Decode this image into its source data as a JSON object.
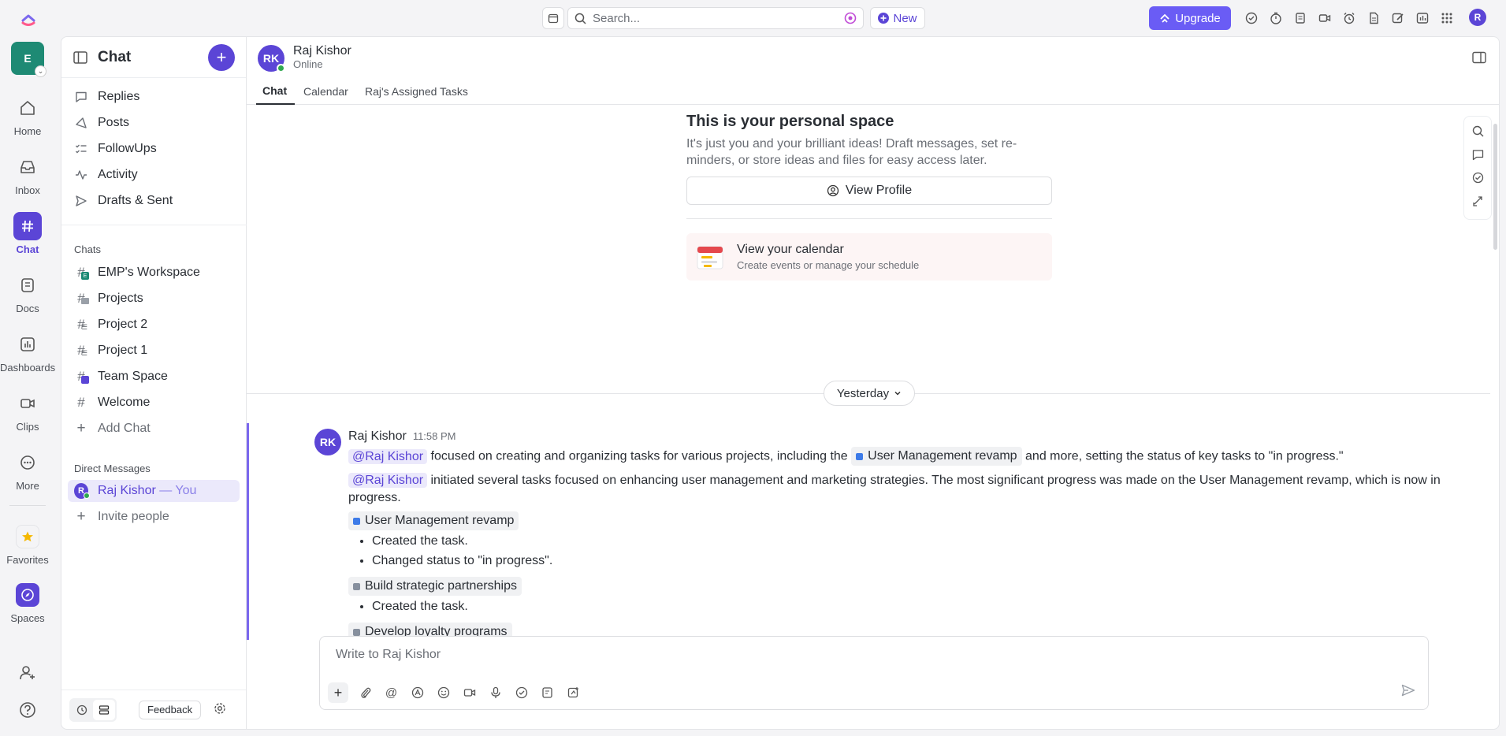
{
  "topbar": {
    "search_placeholder": "Search...",
    "new_label": "New",
    "upgrade_label": "Upgrade",
    "user_initial": "R"
  },
  "rail": {
    "workspace_initial": "E",
    "items": [
      {
        "label": "Home"
      },
      {
        "label": "Inbox"
      },
      {
        "label": "Chat"
      },
      {
        "label": "Docs"
      },
      {
        "label": "Dashboards"
      },
      {
        "label": "Clips"
      },
      {
        "label": "More"
      },
      {
        "label": "Favorites"
      },
      {
        "label": "Spaces"
      }
    ]
  },
  "sidebar": {
    "title": "Chat",
    "top_items": [
      {
        "label": "Replies"
      },
      {
        "label": "Posts"
      },
      {
        "label": "FollowUps"
      },
      {
        "label": "Activity"
      },
      {
        "label": "Drafts & Sent"
      }
    ],
    "chats_header": "Chats",
    "chats": [
      {
        "label": "EMP's Workspace",
        "badge": "E"
      },
      {
        "label": "Projects"
      },
      {
        "label": "Project 2"
      },
      {
        "label": "Project 1"
      },
      {
        "label": "Team Space"
      },
      {
        "label": "Welcome"
      },
      {
        "label": "Add Chat"
      }
    ],
    "dm_header": "Direct Messages",
    "dm_user": "Raj Kishor",
    "dm_you": " — You",
    "dm_initial": "R",
    "invite_label": "Invite people",
    "feedback_label": "Feedback"
  },
  "chat_header": {
    "initials": "RK",
    "name": "Raj Kishor",
    "status": "Online",
    "tabs": [
      {
        "label": "Chat"
      },
      {
        "label": "Calendar"
      },
      {
        "label": "Raj's Assigned Tasks"
      }
    ]
  },
  "personal_space": {
    "title": "This is your personal space",
    "description_line1": "It's just you and your brilliant ideas! Draft messages, set re-",
    "description_line2": "minders, or store ideas and files for easy access later.",
    "view_profile_label": "View Profile",
    "calendar_title": "View your calendar",
    "calendar_subtitle": "Create events or manage your schedule"
  },
  "day_divider": "Yesterday",
  "message": {
    "initials": "RK",
    "author": "Raj Kishor",
    "time": "11:58 PM",
    "mention": "@Raj Kishor",
    "line1_a": "focused on creating and organizing tasks for various projects, including the",
    "line1_chip": "User Management revamp",
    "line1_b": "and more, setting the status of key tasks to \"in progress.\"",
    "line2": "initiated several tasks focused on enhancing user management and marketing strategies. The most significant progress was made on the User Management revamp, which is now in progress.",
    "tasks": [
      {
        "name": "User Management revamp",
        "color": "#3d7be8",
        "bullets": [
          "Created the task.",
          "Changed status to \"in progress\"."
        ]
      },
      {
        "name": "Build strategic partnerships",
        "color": "#87909e",
        "bullets": [
          "Created the task."
        ]
      },
      {
        "name": "Develop loyalty programs",
        "color": "#87909e",
        "bullets": []
      }
    ]
  },
  "composer": {
    "placeholder": "Write to Raj Kishor"
  },
  "colors": {
    "accent": "#5b45d6",
    "upgrade": "#6a5cf5",
    "workspace": "#1e8a74",
    "online": "#2fa84f"
  }
}
